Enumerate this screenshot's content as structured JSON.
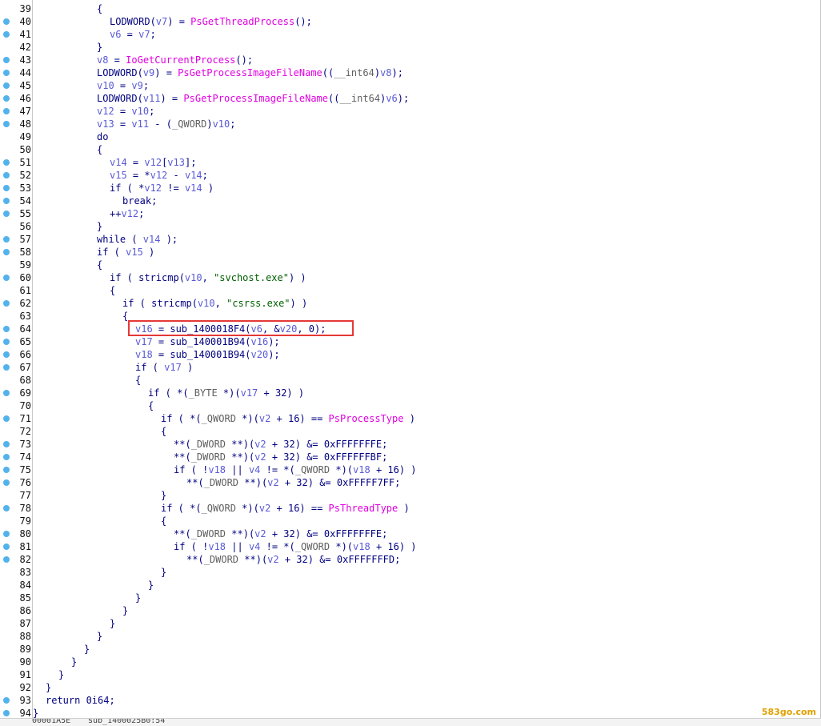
{
  "code_view": {
    "lines": [
      {
        "n": "39",
        "dot": false,
        "indent": 4,
        "tokens": [
          {
            "t": "{",
            "c": ""
          }
        ]
      },
      {
        "n": "40",
        "dot": true,
        "indent": 5,
        "tokens": [
          {
            "t": "LODWORD(",
            "c": ""
          },
          {
            "t": "v7",
            "c": "v"
          },
          {
            "t": ") = ",
            "c": ""
          },
          {
            "t": "PsGetThreadProcess",
            "c": "f"
          },
          {
            "t": "();",
            "c": ""
          }
        ]
      },
      {
        "n": "41",
        "dot": true,
        "indent": 5,
        "tokens": [
          {
            "t": "v6",
            "c": "v"
          },
          {
            "t": " = ",
            "c": ""
          },
          {
            "t": "v7",
            "c": "v"
          },
          {
            "t": ";",
            "c": ""
          }
        ]
      },
      {
        "n": "42",
        "dot": false,
        "indent": 4,
        "tokens": [
          {
            "t": "}",
            "c": ""
          }
        ]
      },
      {
        "n": "43",
        "dot": true,
        "indent": 4,
        "tokens": [
          {
            "t": "v8",
            "c": "v"
          },
          {
            "t": " = ",
            "c": ""
          },
          {
            "t": "IoGetCurrentProcess",
            "c": "f"
          },
          {
            "t": "();",
            "c": ""
          }
        ]
      },
      {
        "n": "44",
        "dot": true,
        "indent": 4,
        "tokens": [
          {
            "t": "LODWORD(",
            "c": ""
          },
          {
            "t": "v9",
            "c": "v"
          },
          {
            "t": ") = ",
            "c": ""
          },
          {
            "t": "PsGetProcessImageFileName",
            "c": "f"
          },
          {
            "t": "((",
            "c": ""
          },
          {
            "t": "__int64",
            "c": "t"
          },
          {
            "t": ")",
            "c": ""
          },
          {
            "t": "v8",
            "c": "v"
          },
          {
            "t": ");",
            "c": ""
          }
        ]
      },
      {
        "n": "45",
        "dot": true,
        "indent": 4,
        "tokens": [
          {
            "t": "v10",
            "c": "v"
          },
          {
            "t": " = ",
            "c": ""
          },
          {
            "t": "v9",
            "c": "v"
          },
          {
            "t": ";",
            "c": ""
          }
        ]
      },
      {
        "n": "46",
        "dot": true,
        "indent": 4,
        "tokens": [
          {
            "t": "LODWORD(",
            "c": ""
          },
          {
            "t": "v11",
            "c": "v"
          },
          {
            "t": ") = ",
            "c": ""
          },
          {
            "t": "PsGetProcessImageFileName",
            "c": "f"
          },
          {
            "t": "((",
            "c": ""
          },
          {
            "t": "__int64",
            "c": "t"
          },
          {
            "t": ")",
            "c": ""
          },
          {
            "t": "v6",
            "c": "v"
          },
          {
            "t": ");",
            "c": ""
          }
        ]
      },
      {
        "n": "47",
        "dot": true,
        "indent": 4,
        "tokens": [
          {
            "t": "v12",
            "c": "v"
          },
          {
            "t": " = ",
            "c": ""
          },
          {
            "t": "v10",
            "c": "v"
          },
          {
            "t": ";",
            "c": ""
          }
        ]
      },
      {
        "n": "48",
        "dot": true,
        "indent": 4,
        "tokens": [
          {
            "t": "v13",
            "c": "v"
          },
          {
            "t": " = ",
            "c": ""
          },
          {
            "t": "v11",
            "c": "v"
          },
          {
            "t": " - (",
            "c": ""
          },
          {
            "t": "_QWORD",
            "c": "t"
          },
          {
            "t": ")",
            "c": ""
          },
          {
            "t": "v10",
            "c": "v"
          },
          {
            "t": ";",
            "c": ""
          }
        ]
      },
      {
        "n": "49",
        "dot": false,
        "indent": 4,
        "tokens": [
          {
            "t": "do",
            "c": ""
          }
        ]
      },
      {
        "n": "50",
        "dot": false,
        "indent": 4,
        "tokens": [
          {
            "t": "{",
            "c": ""
          }
        ]
      },
      {
        "n": "51",
        "dot": true,
        "indent": 5,
        "tokens": [
          {
            "t": "v14",
            "c": "v"
          },
          {
            "t": " = ",
            "c": ""
          },
          {
            "t": "v12",
            "c": "v"
          },
          {
            "t": "[",
            "c": ""
          },
          {
            "t": "v13",
            "c": "v"
          },
          {
            "t": "];",
            "c": ""
          }
        ]
      },
      {
        "n": "52",
        "dot": true,
        "indent": 5,
        "tokens": [
          {
            "t": "v15",
            "c": "v"
          },
          {
            "t": " = *",
            "c": ""
          },
          {
            "t": "v12",
            "c": "v"
          },
          {
            "t": " - ",
            "c": ""
          },
          {
            "t": "v14",
            "c": "v"
          },
          {
            "t": ";",
            "c": ""
          }
        ]
      },
      {
        "n": "53",
        "dot": true,
        "indent": 5,
        "tokens": [
          {
            "t": "if ( *",
            "c": ""
          },
          {
            "t": "v12",
            "c": "v"
          },
          {
            "t": " != ",
            "c": ""
          },
          {
            "t": "v14",
            "c": "v"
          },
          {
            "t": " )",
            "c": ""
          }
        ]
      },
      {
        "n": "54",
        "dot": true,
        "indent": 6,
        "tokens": [
          {
            "t": "break;",
            "c": ""
          }
        ]
      },
      {
        "n": "55",
        "dot": true,
        "indent": 5,
        "tokens": [
          {
            "t": "++",
            "c": ""
          },
          {
            "t": "v12",
            "c": "v"
          },
          {
            "t": ";",
            "c": ""
          }
        ]
      },
      {
        "n": "56",
        "dot": false,
        "indent": 4,
        "tokens": [
          {
            "t": "}",
            "c": ""
          }
        ]
      },
      {
        "n": "57",
        "dot": true,
        "indent": 4,
        "tokens": [
          {
            "t": "while ( ",
            "c": ""
          },
          {
            "t": "v14",
            "c": "v"
          },
          {
            "t": " );",
            "c": ""
          }
        ]
      },
      {
        "n": "58",
        "dot": true,
        "indent": 4,
        "tokens": [
          {
            "t": "if ( ",
            "c": ""
          },
          {
            "t": "v15",
            "c": "v"
          },
          {
            "t": " )",
            "c": ""
          }
        ]
      },
      {
        "n": "59",
        "dot": false,
        "indent": 4,
        "tokens": [
          {
            "t": "{",
            "c": ""
          }
        ]
      },
      {
        "n": "60",
        "dot": true,
        "indent": 5,
        "tokens": [
          {
            "t": "if ( stricmp(",
            "c": ""
          },
          {
            "t": "v10",
            "c": "v"
          },
          {
            "t": ", ",
            "c": ""
          },
          {
            "t": "\"svchost.exe\"",
            "c": "s"
          },
          {
            "t": ") )",
            "c": ""
          }
        ]
      },
      {
        "n": "61",
        "dot": false,
        "indent": 5,
        "tokens": [
          {
            "t": "{",
            "c": ""
          }
        ]
      },
      {
        "n": "62",
        "dot": true,
        "indent": 6,
        "tokens": [
          {
            "t": "if ( stricmp(",
            "c": ""
          },
          {
            "t": "v10",
            "c": "v"
          },
          {
            "t": ", ",
            "c": ""
          },
          {
            "t": "\"csrss.exe\"",
            "c": "s"
          },
          {
            "t": ") )",
            "c": ""
          }
        ]
      },
      {
        "n": "63",
        "dot": false,
        "indent": 6,
        "tokens": [
          {
            "t": "{",
            "c": ""
          }
        ]
      },
      {
        "n": "64",
        "dot": true,
        "indent": 7,
        "tokens": [
          {
            "t": "v16",
            "c": "v"
          },
          {
            "t": " = sub_1400018F4(",
            "c": ""
          },
          {
            "t": "v6",
            "c": "v"
          },
          {
            "t": ", &",
            "c": ""
          },
          {
            "t": "v20",
            "c": "v"
          },
          {
            "t": ", 0);",
            "c": ""
          }
        ]
      },
      {
        "n": "65",
        "dot": true,
        "indent": 7,
        "tokens": [
          {
            "t": "v17",
            "c": "v"
          },
          {
            "t": " = sub_140001B94(",
            "c": ""
          },
          {
            "t": "v16",
            "c": "v"
          },
          {
            "t": ");",
            "c": ""
          }
        ]
      },
      {
        "n": "66",
        "dot": true,
        "indent": 7,
        "tokens": [
          {
            "t": "v18",
            "c": "v"
          },
          {
            "t": " = sub_140001B94(",
            "c": ""
          },
          {
            "t": "v20",
            "c": "v"
          },
          {
            "t": ");",
            "c": ""
          }
        ]
      },
      {
        "n": "67",
        "dot": true,
        "indent": 7,
        "tokens": [
          {
            "t": "if ( ",
            "c": ""
          },
          {
            "t": "v17",
            "c": "v"
          },
          {
            "t": " )",
            "c": ""
          }
        ]
      },
      {
        "n": "68",
        "dot": false,
        "indent": 7,
        "tokens": [
          {
            "t": "{",
            "c": ""
          }
        ]
      },
      {
        "n": "69",
        "dot": true,
        "indent": 8,
        "tokens": [
          {
            "t": "if ( *(",
            "c": ""
          },
          {
            "t": "_BYTE",
            "c": "t"
          },
          {
            "t": " *)(",
            "c": ""
          },
          {
            "t": "v17",
            "c": "v"
          },
          {
            "t": " + 32) )",
            "c": ""
          }
        ]
      },
      {
        "n": "70",
        "dot": false,
        "indent": 8,
        "tokens": [
          {
            "t": "{",
            "c": ""
          }
        ]
      },
      {
        "n": "71",
        "dot": true,
        "indent": 9,
        "tokens": [
          {
            "t": "if ( *(",
            "c": ""
          },
          {
            "t": "_QWORD",
            "c": "t"
          },
          {
            "t": " *)(",
            "c": ""
          },
          {
            "t": "v2",
            "c": "v"
          },
          {
            "t": " + 16) == ",
            "c": ""
          },
          {
            "t": "PsProcessType",
            "c": "f"
          },
          {
            "t": " )",
            "c": ""
          }
        ]
      },
      {
        "n": "72",
        "dot": false,
        "indent": 9,
        "tokens": [
          {
            "t": "{",
            "c": ""
          }
        ]
      },
      {
        "n": "73",
        "dot": true,
        "indent": 10,
        "tokens": [
          {
            "t": "**(",
            "c": ""
          },
          {
            "t": "_DWORD",
            "c": "t"
          },
          {
            "t": " **)(",
            "c": ""
          },
          {
            "t": "v2",
            "c": "v"
          },
          {
            "t": " + 32) &= 0xFFFFFFFE;",
            "c": ""
          }
        ]
      },
      {
        "n": "74",
        "dot": true,
        "indent": 10,
        "tokens": [
          {
            "t": "**(",
            "c": ""
          },
          {
            "t": "_DWORD",
            "c": "t"
          },
          {
            "t": " **)(",
            "c": ""
          },
          {
            "t": "v2",
            "c": "v"
          },
          {
            "t": " + 32) &= 0xFFFFFFBF;",
            "c": ""
          }
        ]
      },
      {
        "n": "75",
        "dot": true,
        "indent": 10,
        "tokens": [
          {
            "t": "if ( !",
            "c": ""
          },
          {
            "t": "v18",
            "c": "v"
          },
          {
            "t": " || ",
            "c": ""
          },
          {
            "t": "v4",
            "c": "v"
          },
          {
            "t": " != *(",
            "c": ""
          },
          {
            "t": "_QWORD",
            "c": "t"
          },
          {
            "t": " *)(",
            "c": ""
          },
          {
            "t": "v18",
            "c": "v"
          },
          {
            "t": " + 16) )",
            "c": ""
          }
        ]
      },
      {
        "n": "76",
        "dot": true,
        "indent": 11,
        "tokens": [
          {
            "t": "**(",
            "c": ""
          },
          {
            "t": "_DWORD",
            "c": "t"
          },
          {
            "t": " **)(",
            "c": ""
          },
          {
            "t": "v2",
            "c": "v"
          },
          {
            "t": " + 32) &= 0xFFFFF7FF;",
            "c": ""
          }
        ]
      },
      {
        "n": "77",
        "dot": false,
        "indent": 9,
        "tokens": [
          {
            "t": "}",
            "c": ""
          }
        ]
      },
      {
        "n": "78",
        "dot": true,
        "indent": 9,
        "tokens": [
          {
            "t": "if ( *(",
            "c": ""
          },
          {
            "t": "_QWORD",
            "c": "t"
          },
          {
            "t": " *)(",
            "c": ""
          },
          {
            "t": "v2",
            "c": "v"
          },
          {
            "t": " + 16) == ",
            "c": ""
          },
          {
            "t": "PsThreadType",
            "c": "f"
          },
          {
            "t": " )",
            "c": ""
          }
        ]
      },
      {
        "n": "79",
        "dot": false,
        "indent": 9,
        "tokens": [
          {
            "t": "{",
            "c": ""
          }
        ]
      },
      {
        "n": "80",
        "dot": true,
        "indent": 10,
        "tokens": [
          {
            "t": "**(",
            "c": ""
          },
          {
            "t": "_DWORD",
            "c": "t"
          },
          {
            "t": " **)(",
            "c": ""
          },
          {
            "t": "v2",
            "c": "v"
          },
          {
            "t": " + 32) &= 0xFFFFFFFE;",
            "c": ""
          }
        ]
      },
      {
        "n": "81",
        "dot": true,
        "indent": 10,
        "tokens": [
          {
            "t": "if ( !",
            "c": ""
          },
          {
            "t": "v18",
            "c": "v"
          },
          {
            "t": " || ",
            "c": ""
          },
          {
            "t": "v4",
            "c": "v"
          },
          {
            "t": " != *(",
            "c": ""
          },
          {
            "t": "_QWORD",
            "c": "t"
          },
          {
            "t": " *)(",
            "c": ""
          },
          {
            "t": "v18",
            "c": "v"
          },
          {
            "t": " + 16) )",
            "c": ""
          }
        ]
      },
      {
        "n": "82",
        "dot": true,
        "indent": 11,
        "tokens": [
          {
            "t": "**(",
            "c": ""
          },
          {
            "t": "_DWORD",
            "c": "t"
          },
          {
            "t": " **)(",
            "c": ""
          },
          {
            "t": "v2",
            "c": "v"
          },
          {
            "t": " + 32) &= 0xFFFFFFFD;",
            "c": ""
          }
        ]
      },
      {
        "n": "83",
        "dot": false,
        "indent": 9,
        "tokens": [
          {
            "t": "}",
            "c": ""
          }
        ]
      },
      {
        "n": "84",
        "dot": false,
        "indent": 8,
        "tokens": [
          {
            "t": "}",
            "c": ""
          }
        ]
      },
      {
        "n": "85",
        "dot": false,
        "indent": 7,
        "tokens": [
          {
            "t": "}",
            "c": ""
          }
        ]
      },
      {
        "n": "86",
        "dot": false,
        "indent": 6,
        "tokens": [
          {
            "t": "}",
            "c": ""
          }
        ]
      },
      {
        "n": "87",
        "dot": false,
        "indent": 5,
        "tokens": [
          {
            "t": "}",
            "c": ""
          }
        ]
      },
      {
        "n": "88",
        "dot": false,
        "indent": 4,
        "tokens": [
          {
            "t": "}",
            "c": ""
          }
        ]
      },
      {
        "n": "89",
        "dot": false,
        "indent": 3,
        "tokens": [
          {
            "t": "}",
            "c": ""
          }
        ]
      },
      {
        "n": "90",
        "dot": false,
        "indent": 2,
        "tokens": [
          {
            "t": "}",
            "c": ""
          }
        ]
      },
      {
        "n": "91",
        "dot": false,
        "indent": 1,
        "tokens": [
          {
            "t": "}",
            "c": ""
          }
        ]
      },
      {
        "n": "92",
        "dot": false,
        "indent": 0,
        "tokens": [
          {
            "t": "}",
            "c": ""
          }
        ]
      },
      {
        "n": "93",
        "dot": true,
        "indent": 0,
        "tokens": [
          {
            "t": "return 0i64;",
            "c": ""
          }
        ]
      },
      {
        "n": "94",
        "dot": true,
        "indent": -1,
        "tokens": [
          {
            "t": "}",
            "c": ""
          }
        ]
      }
    ]
  },
  "status_bar": {
    "left": "00001A5E",
    "right": "sub_1400025B0:54"
  },
  "watermark": "583go.com",
  "colors": {
    "variable": "#5959d8",
    "function": "#e000e0",
    "string": "#006000",
    "type": "#5f5f5f",
    "code": "#000080",
    "highlight": "#e53935",
    "dot": "#53b2ec"
  }
}
